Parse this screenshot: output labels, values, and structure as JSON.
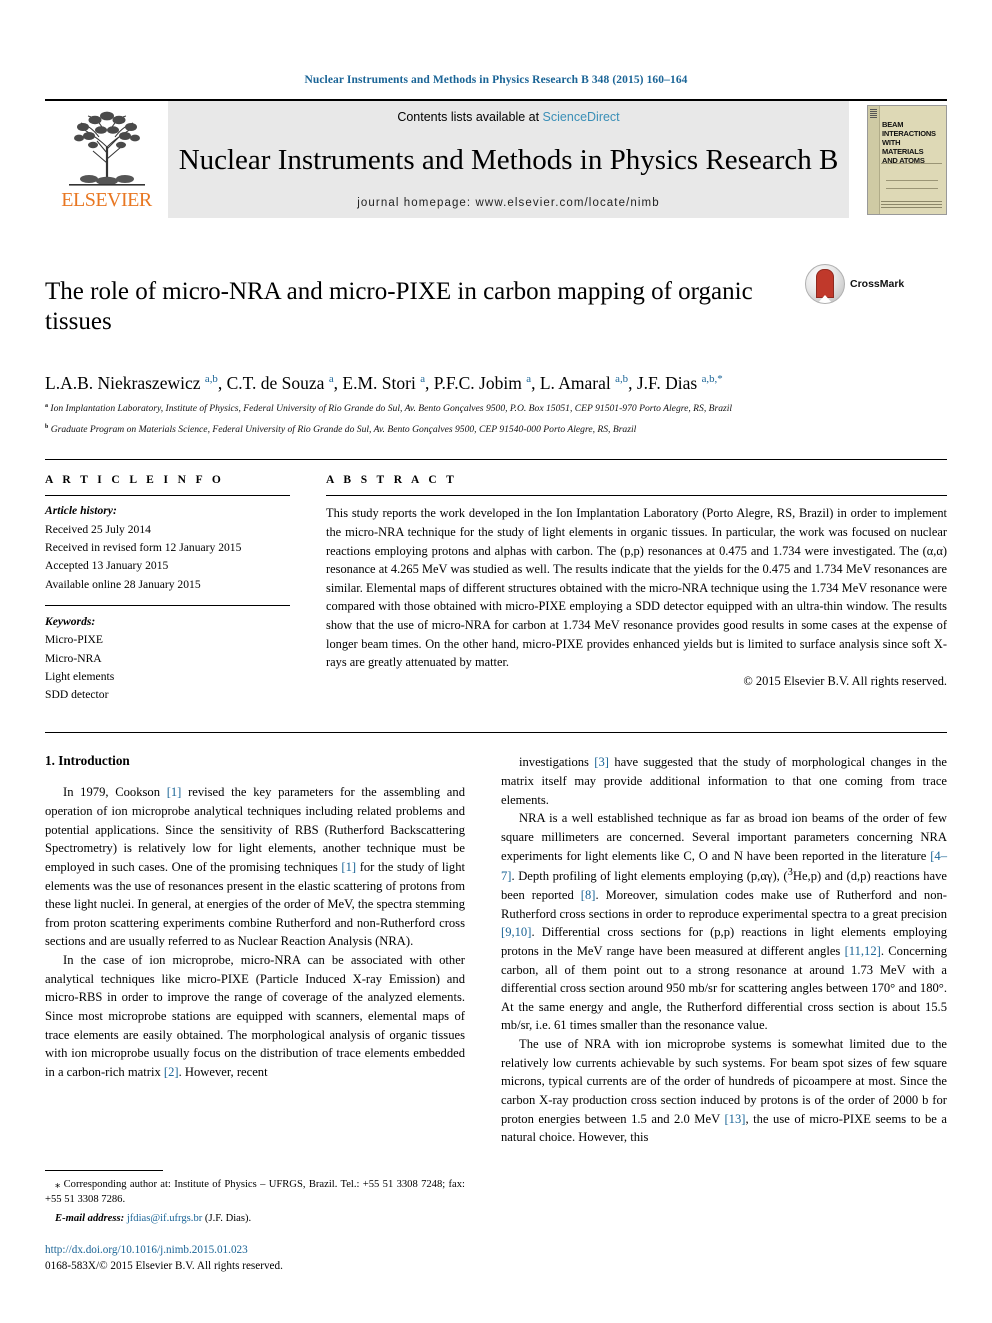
{
  "running_head": "Nuclear Instruments and Methods in Physics Research B 348 (2015) 160–164",
  "banner": {
    "contents_prefix": "Contents lists available at ",
    "sciencedirect": "ScienceDirect",
    "journal_title": "Nuclear Instruments and Methods in Physics Research B",
    "homepage": "journal homepage: www.elsevier.com/locate/nimb",
    "publisher": "ELSEVIER",
    "cover_title": "BEAM\nINTERACTIONS\nWITH\nMATERIALS\nAND ATOMS"
  },
  "article": {
    "title": "The role of micro-NRA and micro-PIXE in carbon mapping of organic tissues",
    "crossmark_label": "CrossMark",
    "authors_html": "L.A.B. Niekraszewicz <sup>a,b</sup>, C.T. de Souza <sup>a</sup>, E.M. Stori <sup>a</sup>, P.F.C. Jobim <sup>a</sup>, L. Amaral <sup>a,b</sup>, J.F. Dias <sup>a,b,<span class=\"star\">*</span></sup>",
    "affiliation_a": "Ion Implantation Laboratory, Institute of Physics, Federal University of Rio Grande do Sul, Av. Bento Gonçalves 9500, P.O. Box 15051, CEP 91501-970 Porto Alegre, RS, Brazil",
    "affiliation_b": "Graduate Program on Materials Science, Federal University of Rio Grande do Sul, Av. Bento Gonçalves 9500, CEP 91540-000 Porto Alegre, RS, Brazil"
  },
  "article_info": {
    "heading": "A R T I C L E    I N F O",
    "history_label": "Article history:",
    "history": [
      "Received 25 July 2014",
      "Received in revised form 12 January 2015",
      "Accepted 13 January 2015",
      "Available online 28 January 2015"
    ],
    "keywords_label": "Keywords:",
    "keywords": [
      "Micro-PIXE",
      "Micro-NRA",
      "Light elements",
      "SDD detector"
    ]
  },
  "abstract": {
    "heading": "A B S T R A C T",
    "text": "This study reports the work developed in the Ion Implantation Laboratory (Porto Alegre, RS, Brazil) in order to implement the micro-NRA technique for the study of light elements in organic tissues. In particular, the work was focused on nuclear reactions employing protons and alphas with carbon. The (p,p) resonances at 0.475 and 1.734 were investigated. The (α,α) resonance at 4.265 MeV was studied as well. The results indicate that the yields for the 0.475 and 1.734 MeV resonances are similar. Elemental maps of different structures obtained with the micro-NRA technique using the 1.734 MeV resonance were compared with those obtained with micro-PIXE employing a SDD detector equipped with an ultra-thin window. The results show that the use of micro-NRA for carbon at 1.734 MeV resonance provides good results in some cases at the expense of longer beam times. On the other hand, micro-PIXE provides enhanced yields but is limited to surface analysis since soft X-rays are greatly attenuated by matter.",
    "copyright": "© 2015 Elsevier B.V. All rights reserved."
  },
  "body": {
    "section_heading": "1. Introduction",
    "left_paragraphs_html": [
      "In 1979, Cookson <span class=\"ref\">[1]</span> revised the key parameters for the assembling and operation of ion microprobe analytical techniques including related problems and potential applications. Since the sensitivity of RBS (Rutherford Backscattering Spectrometry) is relatively low for light elements, another technique must be employed in such cases. One of the promising techniques <span class=\"ref\">[1]</span> for the study of light elements was the use of resonances present in the elastic scattering of protons from these light nuclei. In general, at energies of the order of MeV, the spectra stemming from proton scattering experiments combine Rutherford and non-Rutherford cross sections and are usually referred to as Nuclear Reaction Analysis (NRA).",
      "In the case of ion microprobe, micro-NRA can be associated with other analytical techniques like micro-PIXE (Particle Induced X-ray Emission) and micro-RBS in order to improve the range of coverage of the analyzed elements. Since most microprobe stations are equipped with scanners, elemental maps of trace elements are easily obtained. The morphological analysis of organic tissues with ion microprobe usually focus on the distribution of trace elements embedded in a carbon-rich matrix <span class=\"ref\">[2]</span>. However, recent"
    ],
    "right_paragraphs_html": [
      "investigations <span class=\"ref\">[3]</span> have suggested that the study of morphological changes in the matrix itself may provide additional information to that one coming from trace elements.",
      "NRA is a well established technique as far as broad ion beams of the order of few square millimeters are concerned. Several important parameters concerning NRA experiments for light elements like C, O and N have been reported in the literature <span class=\"ref\">[4–7]</span>. Depth profiling of light elements employing (p,αγ), (<sup>3</sup>He,p) and (d,p) reactions have been reported <span class=\"ref\">[8]</span>. Moreover, simulation codes make use of Rutherford and non-Rutherford cross sections in order to reproduce experimental spectra to a great precision <span class=\"ref\">[9,10]</span>. Differential cross sections for (p,p) reactions in light elements employing protons in the MeV range have been measured at different angles <span class=\"ref\">[11,12]</span>. Concerning carbon, all of them point out to a strong resonance at around 1.73 MeV with a differential cross section around 950 mb/sr for scattering angles between 170° and 180°. At the same energy and angle, the Rutherford differential cross section is about 15.5 mb/sr, i.e. 61 times smaller than the resonance value.",
      "The use of NRA with ion microprobe systems is somewhat limited due to the relatively low currents achievable by such systems. For beam spot sizes of few square microns, typical currents are of the order of hundreds of picoampere at most. Since the carbon X-ray production cross section induced by protons is of the order of 2000 b for proton energies between 1.5 and 2.0 MeV <span class=\"ref\">[13]</span>, the use of micro-PIXE seems to be a natural choice. However, this"
    ]
  },
  "footnote": {
    "corresponding_html": "<span class=\"ind\"></span>⁎ Corresponding author at: Institute of Physics – UFRGS, Brazil. Tel.: +55 51 3308 7248; fax: +55 51 3308 7286.",
    "email_label": "E-mail address:",
    "email": "jfdias@if.ufrgs.br",
    "email_suffix": " (J.F. Dias).",
    "doi": "http://dx.doi.org/10.1016/j.nimb.2015.01.023",
    "issn_line": "0168-583X/© 2015 Elsevier B.V. All rights reserved."
  }
}
